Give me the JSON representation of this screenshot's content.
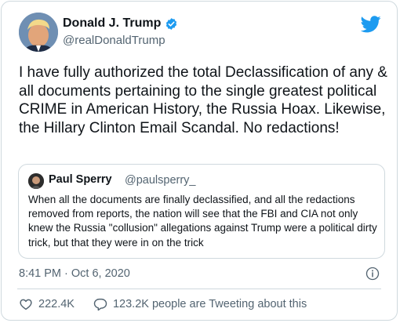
{
  "author": {
    "name": "Donald J. Trump",
    "handle": "@realDonaldTrump"
  },
  "tweet": {
    "text": "I have fully authorized the total Declassification of any & all documents pertaining to the single greatest political CRIME in American History, the Russia Hoax. Likewise, the Hillary Clinton Email Scandal. No redactions!"
  },
  "quote": {
    "name": "Paul Sperry",
    "handle": "@paulsperry_",
    "text": "When all the documents are finally declassified, and all the redactions removed from reports, the nation will see that the FBI and CIA not only knew the Russia \"collusion\" allegations against Trump were a political dirty trick, but that they were in on the trick"
  },
  "meta": {
    "timestamp": "8:41 PM · Oct 6, 2020"
  },
  "actions": {
    "likes": "222.4K",
    "conversation": "123.2K people are Tweeting about this"
  },
  "colors": {
    "brand": "#1d9bf0",
    "muted": "#536471",
    "border": "#cfd9de"
  },
  "icons": [
    "verified-badge-icon",
    "twitter-bird-icon",
    "info-icon",
    "heart-icon",
    "reply-bubble-icon"
  ]
}
